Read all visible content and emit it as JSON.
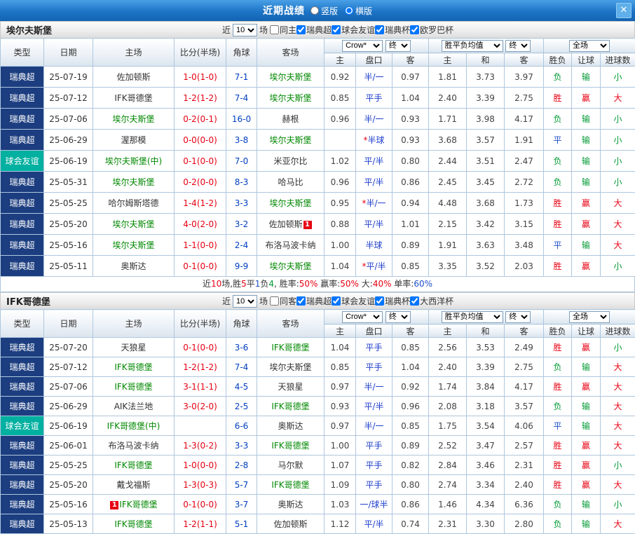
{
  "topbar": {
    "title": "近期战绩",
    "radios": [
      {
        "label": "竖版",
        "selected": false
      },
      {
        "label": "横版",
        "selected": true
      }
    ],
    "close_label": "✕"
  },
  "ui": {
    "near": "近",
    "games": "场"
  },
  "columns": {
    "type": "类型",
    "date": "日期",
    "home": "主场",
    "score": "比分(半场)",
    "corner": "角球",
    "away": "客场",
    "asia_company": "Crow*",
    "asia_final": "终",
    "euro_company": "胜平负均值",
    "euro_final": "终",
    "scope": "全场",
    "asia_sub": [
      "主",
      "盘口",
      "客"
    ],
    "euro_sub": [
      "主",
      "和",
      "客"
    ],
    "result_sub": [
      "胜负",
      "让球",
      "进球数"
    ]
  },
  "result_colors": {
    "胜": "#e60012",
    "负": "#009933",
    "平": "#1e50c8",
    "赢": "#e60012",
    "输": "#009933",
    "大": "#e60012",
    "小": "#009933"
  },
  "sections": [
    {
      "team": "埃尔夫斯堡",
      "filter": {
        "count": "10",
        "checkboxes": [
          {
            "label": "同主",
            "checked": false
          },
          {
            "label": "瑞典超",
            "checked": true
          },
          {
            "label": "球会友谊",
            "checked": true
          },
          {
            "label": "瑞典杯",
            "checked": true
          },
          {
            "label": "欧罗巴杯",
            "checked": true
          }
        ]
      },
      "rows": [
        {
          "league": "瑞典超",
          "league_style": "navy",
          "date": "25-07-19",
          "home": {
            "text": "佐加顿斯",
            "focus": false
          },
          "score": "1-0(1-0)",
          "corner": "7-1",
          "away": {
            "text": "埃尔夫斯堡",
            "focus": true
          },
          "asia": [
            "0.92",
            "半/一",
            "0.97"
          ],
          "euro": [
            "1.81",
            "3.73",
            "3.97"
          ],
          "result": [
            "负",
            "输",
            "小"
          ]
        },
        {
          "league": "瑞典超",
          "league_style": "navy",
          "date": "25-07-12",
          "home": {
            "text": "IFK哥德堡",
            "focus": false
          },
          "score": "1-2(1-2)",
          "corner": "7-4",
          "away": {
            "text": "埃尔夫斯堡",
            "focus": true
          },
          "asia": [
            "0.85",
            "平手",
            "1.04"
          ],
          "euro": [
            "2.40",
            "3.39",
            "2.75"
          ],
          "result": [
            "胜",
            "赢",
            "大"
          ]
        },
        {
          "league": "瑞典超",
          "league_style": "navy",
          "date": "25-07-06",
          "home": {
            "text": "埃尔夫斯堡",
            "focus": true
          },
          "score": "0-2(0-1)",
          "corner": "16-0",
          "away": {
            "text": "赫根",
            "focus": false
          },
          "asia": [
            "0.96",
            "半/一",
            "0.93"
          ],
          "euro": [
            "1.71",
            "3.98",
            "4.17"
          ],
          "result": [
            "负",
            "输",
            "小"
          ]
        },
        {
          "league": "瑞典超",
          "league_style": "navy",
          "date": "25-06-29",
          "home": {
            "text": "渥那模",
            "focus": false
          },
          "score": "0-0(0-0)",
          "corner": "3-8",
          "away": {
            "text": "埃尔夫斯堡",
            "focus": true
          },
          "asia": [
            "",
            "*半球",
            "0.93"
          ],
          "euro": [
            "3.68",
            "3.57",
            "1.91"
          ],
          "result": [
            "平",
            "输",
            "小"
          ]
        },
        {
          "league": "球会友谊",
          "league_style": "teal",
          "date": "25-06-19",
          "home": {
            "text": "埃尔夫斯堡(中)",
            "focus": true
          },
          "score": "0-1(0-0)",
          "corner": "7-0",
          "away": {
            "text": "米亚尔比",
            "focus": false
          },
          "asia": [
            "1.02",
            "平/半",
            "0.80"
          ],
          "euro": [
            "2.44",
            "3.51",
            "2.47"
          ],
          "result": [
            "负",
            "输",
            "小"
          ]
        },
        {
          "league": "瑞典超",
          "league_style": "navy",
          "date": "25-05-31",
          "home": {
            "text": "埃尔夫斯堡",
            "focus": true
          },
          "score": "0-2(0-0)",
          "corner": "8-3",
          "away": {
            "text": "哈马比",
            "focus": false
          },
          "asia": [
            "0.96",
            "平/半",
            "0.86"
          ],
          "euro": [
            "2.45",
            "3.45",
            "2.72"
          ],
          "result": [
            "负",
            "输",
            "小"
          ]
        },
        {
          "league": "瑞典超",
          "league_style": "navy",
          "date": "25-05-25",
          "home": {
            "text": "哈尔姆斯塔德",
            "focus": false
          },
          "score": "1-4(1-2)",
          "corner": "3-3",
          "away": {
            "text": "埃尔夫斯堡",
            "focus": true
          },
          "asia": [
            "0.95",
            "*半/一",
            "0.94"
          ],
          "euro": [
            "4.48",
            "3.68",
            "1.73"
          ],
          "result": [
            "胜",
            "赢",
            "大"
          ]
        },
        {
          "league": "瑞典超",
          "league_style": "navy",
          "date": "25-05-20",
          "home": {
            "text": "埃尔夫斯堡",
            "focus": true
          },
          "score": "4-0(2-0)",
          "corner": "3-2",
          "away": {
            "text": "佐加顿斯",
            "focus": false,
            "badge": "1",
            "badge_pos": "after"
          },
          "asia": [
            "0.88",
            "平/半",
            "1.01"
          ],
          "euro": [
            "2.15",
            "3.42",
            "3.15"
          ],
          "result": [
            "胜",
            "赢",
            "大"
          ]
        },
        {
          "league": "瑞典超",
          "league_style": "navy",
          "date": "25-05-16",
          "home": {
            "text": "埃尔夫斯堡",
            "focus": true
          },
          "score": "1-1(0-0)",
          "corner": "2-4",
          "away": {
            "text": "布洛马波卡纳",
            "focus": false
          },
          "asia": [
            "1.00",
            "半球",
            "0.89"
          ],
          "euro": [
            "1.91",
            "3.63",
            "3.48"
          ],
          "result": [
            "平",
            "输",
            "大"
          ]
        },
        {
          "league": "瑞典超",
          "league_style": "navy",
          "date": "25-05-11",
          "home": {
            "text": "奥斯达",
            "focus": false
          },
          "score": "0-1(0-0)",
          "corner": "9-9",
          "away": {
            "text": "埃尔夫斯堡",
            "focus": true
          },
          "asia": [
            "1.04",
            "*平/半",
            "0.85"
          ],
          "euro": [
            "3.35",
            "3.52",
            "2.03"
          ],
          "result": [
            "胜",
            "赢",
            "小"
          ]
        }
      ],
      "summary": [
        {
          "t": "近",
          "c": "#333333"
        },
        {
          "t": "10",
          "c": "#e60012"
        },
        {
          "t": "场,胜",
          "c": "#333333"
        },
        {
          "t": "5",
          "c": "#e60012"
        },
        {
          "t": "平",
          "c": "#333333"
        },
        {
          "t": "1",
          "c": "#1e50c8"
        },
        {
          "t": "负",
          "c": "#333333"
        },
        {
          "t": "4",
          "c": "#009933"
        },
        {
          "t": ", 胜率:",
          "c": "#333333"
        },
        {
          "t": "50%",
          "c": "#e60012"
        },
        {
          "t": " 赢率:",
          "c": "#333333"
        },
        {
          "t": "50%",
          "c": "#e60012"
        },
        {
          "t": " 大:",
          "c": "#333333"
        },
        {
          "t": "40%",
          "c": "#e60012"
        },
        {
          "t": " 单率:",
          "c": "#333333"
        },
        {
          "t": "60%",
          "c": "#1e50c8"
        }
      ]
    },
    {
      "team": "IFK哥德堡",
      "filter": {
        "count": "10",
        "checkboxes": [
          {
            "label": "同客",
            "checked": false
          },
          {
            "label": "瑞典超",
            "checked": true
          },
          {
            "label": "球会友谊",
            "checked": true
          },
          {
            "label": "瑞典杯",
            "checked": true
          },
          {
            "label": "大西洋杯",
            "checked": true
          }
        ]
      },
      "rows": [
        {
          "league": "瑞典超",
          "league_style": "navy",
          "date": "25-07-20",
          "home": {
            "text": "天狼星",
            "focus": false
          },
          "score": "0-1(0-0)",
          "corner": "3-6",
          "away": {
            "text": "IFK哥德堡",
            "focus": true
          },
          "asia": [
            "1.04",
            "平手",
            "0.85"
          ],
          "euro": [
            "2.56",
            "3.53",
            "2.49"
          ],
          "result": [
            "胜",
            "赢",
            "小"
          ]
        },
        {
          "league": "瑞典超",
          "league_style": "navy",
          "date": "25-07-12",
          "home": {
            "text": "IFK哥德堡",
            "focus": true
          },
          "score": "1-2(1-2)",
          "corner": "7-4",
          "away": {
            "text": "埃尔夫斯堡",
            "focus": false
          },
          "asia": [
            "0.85",
            "平手",
            "1.04"
          ],
          "euro": [
            "2.40",
            "3.39",
            "2.75"
          ],
          "result": [
            "负",
            "输",
            "大"
          ]
        },
        {
          "league": "瑞典超",
          "league_style": "navy",
          "date": "25-07-06",
          "home": {
            "text": "IFK哥德堡",
            "focus": true
          },
          "score": "3-1(1-1)",
          "corner": "4-5",
          "away": {
            "text": "天狼星",
            "focus": false
          },
          "asia": [
            "0.97",
            "半/一",
            "0.92"
          ],
          "euro": [
            "1.74",
            "3.84",
            "4.17"
          ],
          "result": [
            "胜",
            "赢",
            "大"
          ]
        },
        {
          "league": "瑞典超",
          "league_style": "navy",
          "date": "25-06-29",
          "home": {
            "text": "AIK法兰地",
            "focus": false
          },
          "score": "3-0(2-0)",
          "corner": "2-5",
          "away": {
            "text": "IFK哥德堡",
            "focus": true
          },
          "asia": [
            "0.93",
            "平/半",
            "0.96"
          ],
          "euro": [
            "2.08",
            "3.18",
            "3.57"
          ],
          "result": [
            "负",
            "输",
            "大"
          ]
        },
        {
          "league": "球会友谊",
          "league_style": "teal",
          "date": "25-06-19",
          "home": {
            "text": "IFK哥德堡(中)",
            "focus": true
          },
          "score": "",
          "corner": "6-6",
          "away": {
            "text": "奥斯达",
            "focus": false
          },
          "asia": [
            "0.97",
            "半/一",
            "0.85"
          ],
          "euro": [
            "1.75",
            "3.54",
            "4.06"
          ],
          "result": [
            "平",
            "输",
            "大"
          ]
        },
        {
          "league": "瑞典超",
          "league_style": "navy",
          "date": "25-06-01",
          "home": {
            "text": "布洛马波卡纳",
            "focus": false
          },
          "score": "1-3(0-2)",
          "corner": "3-3",
          "away": {
            "text": "IFK哥德堡",
            "focus": true
          },
          "asia": [
            "1.00",
            "平手",
            "0.89"
          ],
          "euro": [
            "2.52",
            "3.47",
            "2.57"
          ],
          "result": [
            "胜",
            "赢",
            "大"
          ]
        },
        {
          "league": "瑞典超",
          "league_style": "navy",
          "date": "25-05-25",
          "home": {
            "text": "IFK哥德堡",
            "focus": true
          },
          "score": "1-0(0-0)",
          "corner": "2-8",
          "away": {
            "text": "马尔默",
            "focus": false
          },
          "asia": [
            "1.07",
            "平手",
            "0.82"
          ],
          "euro": [
            "2.84",
            "3.46",
            "2.31"
          ],
          "result": [
            "胜",
            "赢",
            "小"
          ]
        },
        {
          "league": "瑞典超",
          "league_style": "navy",
          "date": "25-05-20",
          "home": {
            "text": "戴戈福斯",
            "focus": false
          },
          "score": "1-3(0-3)",
          "corner": "5-7",
          "away": {
            "text": "IFK哥德堡",
            "focus": true
          },
          "asia": [
            "1.09",
            "平手",
            "0.80"
          ],
          "euro": [
            "2.74",
            "3.34",
            "2.40"
          ],
          "result": [
            "胜",
            "赢",
            "大"
          ]
        },
        {
          "league": "瑞典超",
          "league_style": "navy",
          "date": "25-05-16",
          "home": {
            "text": "IFK哥德堡",
            "focus": true,
            "badge": "1",
            "badge_pos": "before"
          },
          "score": "0-1(0-0)",
          "corner": "3-7",
          "away": {
            "text": "奥斯达",
            "focus": false
          },
          "asia": [
            "1.03",
            "一/球半",
            "0.86"
          ],
          "euro": [
            "1.46",
            "4.34",
            "6.36"
          ],
          "result": [
            "负",
            "输",
            "小"
          ]
        },
        {
          "league": "瑞典超",
          "league_style": "navy",
          "date": "25-05-13",
          "home": {
            "text": "IFK哥德堡",
            "focus": true
          },
          "score": "1-2(1-1)",
          "corner": "5-1",
          "away": {
            "text": "佐加顿斯",
            "focus": false
          },
          "asia": [
            "1.12",
            "平/半",
            "0.74"
          ],
          "euro": [
            "2.31",
            "3.30",
            "2.80"
          ],
          "result": [
            "负",
            "输",
            "大"
          ]
        }
      ]
    }
  ]
}
